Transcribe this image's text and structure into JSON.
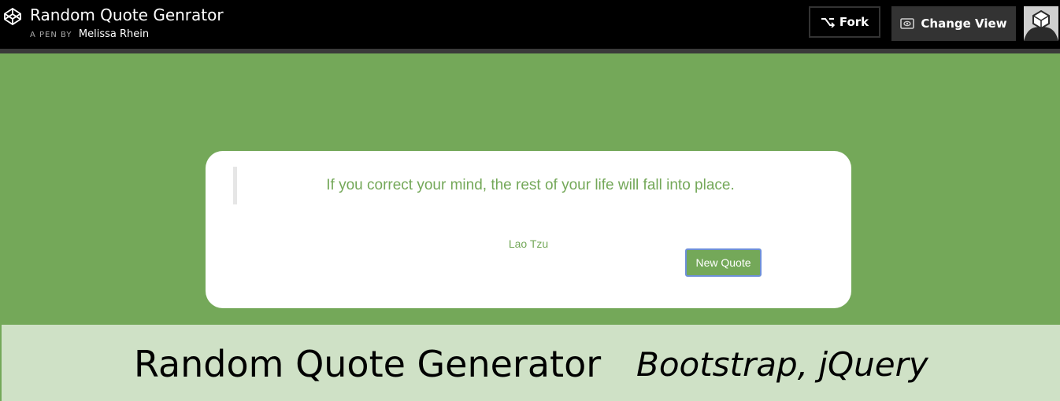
{
  "header": {
    "logo_icon": "codepen-icon",
    "pen_title": "Random Quote Genrator",
    "pen_by_prefix": "A PEN BY",
    "author": "Melissa Rhein",
    "fork_label": "Fork",
    "fork_icon": "fork-icon",
    "change_view_label": "Change View",
    "change_view_icon": "eye-icon",
    "avatar_icon": "user-avatar-icon"
  },
  "quote_card": {
    "quote": "If you correct your mind, the rest of your life will fall into place.",
    "author": "Lao Tzu",
    "new_quote_label": "New Quote"
  },
  "banner": {
    "title": "Random Quote Generator",
    "tech": "Bootstrap, jQuery"
  },
  "colors": {
    "accent_green": "#74a859",
    "banner_green": "#cfe1c6",
    "topbar": "#000000",
    "button_dark": "#333333"
  }
}
